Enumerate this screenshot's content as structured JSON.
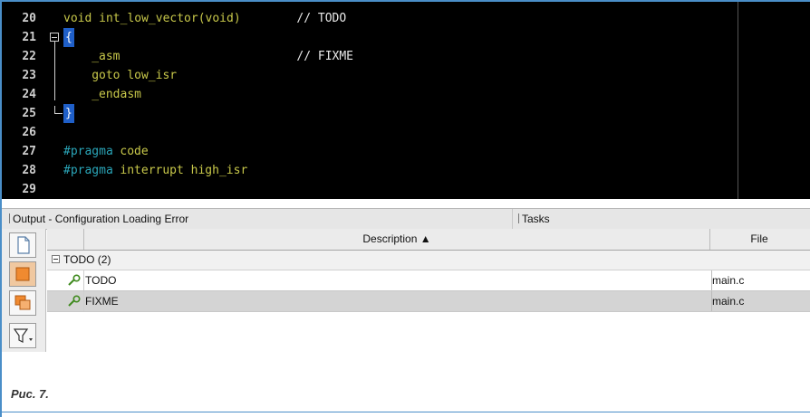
{
  "editor": {
    "lines": [
      {
        "num": "20",
        "tokens": [
          {
            "t": "void int_low_vector(void)",
            "c": "kw"
          },
          {
            "t": "// TODO",
            "c": "cm",
            "col": 33
          }
        ]
      },
      {
        "num": "21",
        "tokens": [
          {
            "t": "{",
            "c": "brace"
          }
        ]
      },
      {
        "num": "22",
        "tokens": [
          {
            "t": "_asm",
            "c": "kw",
            "col": 4
          },
          {
            "t": "// FIXME",
            "c": "cm",
            "col": 33
          }
        ]
      },
      {
        "num": "23",
        "tokens": [
          {
            "t": "goto low_isr",
            "c": "kw",
            "col": 4
          }
        ]
      },
      {
        "num": "24",
        "tokens": [
          {
            "t": "_endasm",
            "c": "kw",
            "col": 4
          }
        ]
      },
      {
        "num": "25",
        "tokens": [
          {
            "t": "}",
            "c": "brace"
          }
        ]
      },
      {
        "num": "26",
        "tokens": []
      },
      {
        "num": "27",
        "tokens": [
          {
            "t": "#pragma",
            "c": "pp"
          },
          {
            "t": "code",
            "c": "kw",
            "col": 8
          }
        ]
      },
      {
        "num": "28",
        "tokens": [
          {
            "t": "#pragma",
            "c": "pp"
          },
          {
            "t": "interrupt high_isr",
            "c": "kw",
            "col": 8
          }
        ]
      },
      {
        "num": "29",
        "tokens": []
      }
    ]
  },
  "tabs": {
    "output": "Output - Configuration Loading Error",
    "tasks": "Tasks"
  },
  "toolbar": {
    "buttons": [
      "document-icon",
      "orange-box-icon",
      "stacked-boxes-icon",
      "filter-icon"
    ]
  },
  "tasks_table": {
    "columns": {
      "description": "Description ▲",
      "file": "File"
    },
    "group": "TODO (2)",
    "rows": [
      {
        "description": "TODO",
        "file": "main.c"
      },
      {
        "description": "FIXME",
        "file": "main.c"
      }
    ]
  },
  "caption": "Рис. 7.",
  "colors": {
    "editor_bg": "#000000",
    "code_keyword": "#c8c84a",
    "code_preprocessor": "#2aa5b8",
    "brace_highlight": "#1f5fc8",
    "frame_accent": "#4a8ec8"
  }
}
